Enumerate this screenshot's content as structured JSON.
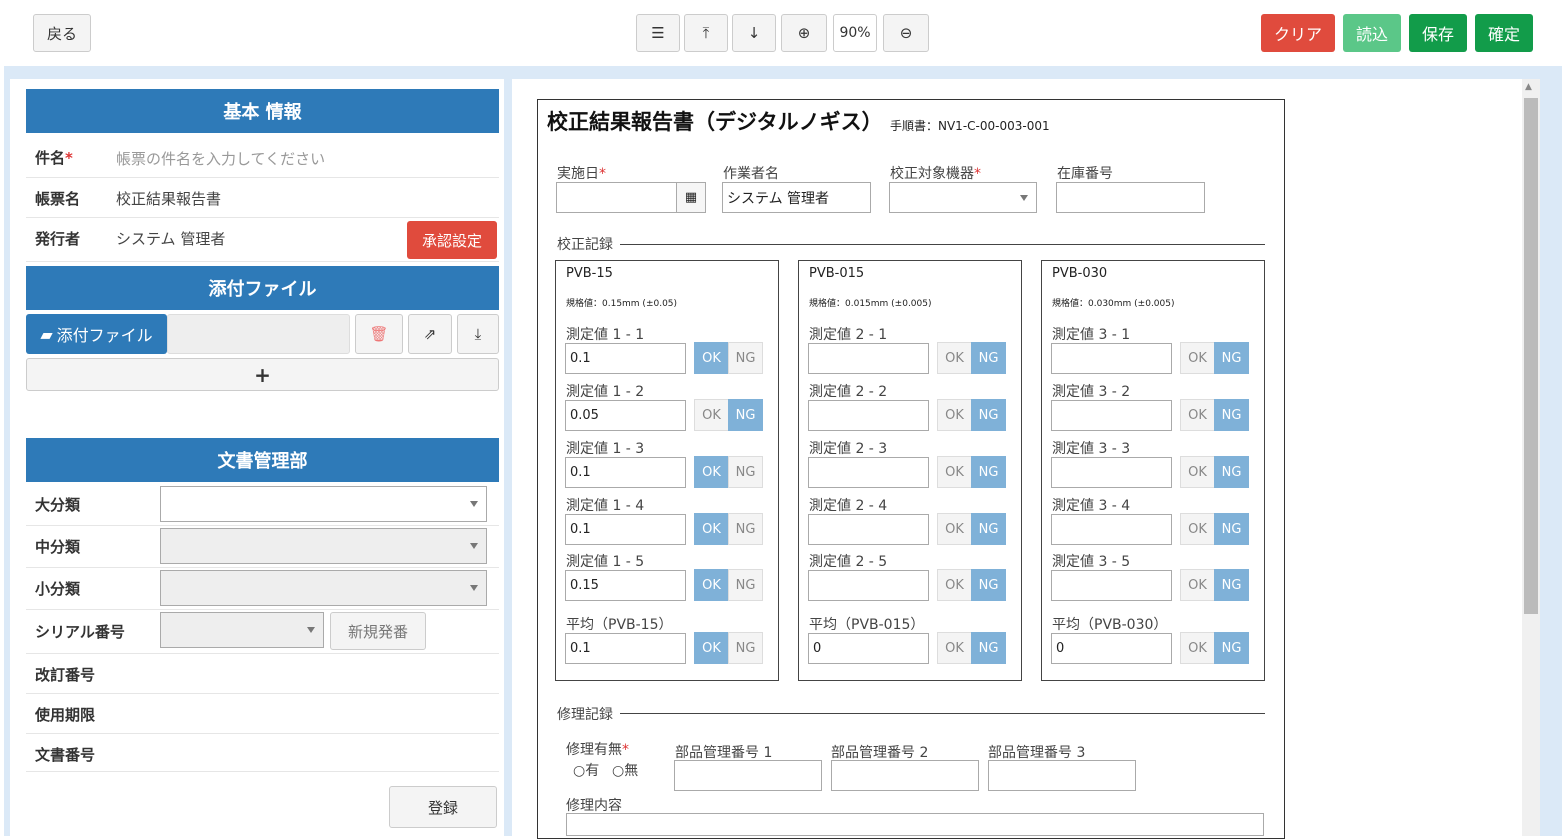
{
  "toolbar": {
    "back": "戻る",
    "zoom": "90%",
    "clear": "クリア",
    "load": "読込",
    "save": "保存",
    "confirm": "確定"
  },
  "left": {
    "basic_title": "基本 情報",
    "subject_label": "件名",
    "subject_placeholder": "帳票の件名を入力してください",
    "form_label": "帳票名",
    "form_value": "校正結果報告書",
    "issuer_label": "発行者",
    "issuer_value": "システム 管理者",
    "approval_btn": "承認設定",
    "attach_title": "添付ファイル",
    "attach_btn": "添付ファイル",
    "add": "+",
    "doc_title": "文書管理部",
    "cat_large": "大分類",
    "cat_mid": "中分類",
    "cat_small": "小分類",
    "serial_label": "シリアル番号",
    "new_serial": "新規発番",
    "revision": "改訂番号",
    "expiry": "使用期限",
    "docno": "文書番号",
    "register": "登録"
  },
  "doc": {
    "title": "校正結果報告書（デジタルノギス）",
    "procedure": "手順書：NV1-C-00-003-001",
    "date_label": "実施日",
    "worker_label": "作業者名",
    "worker_value": "システム 管理者",
    "device_label": "校正対象機器",
    "stock_label": "在庫番号",
    "calib_section": "校正記録",
    "ok": "OK",
    "ng": "NG",
    "groups": [
      {
        "name": "PVB-15",
        "spec": "規格値：0.15mm (±0.05)",
        "meas": [
          {
            "label": "測定値 1 - 1",
            "value": "0.1",
            "state": "ok"
          },
          {
            "label": "測定値 1 - 2",
            "value": "0.05",
            "state": "ng"
          },
          {
            "label": "測定値 1 - 3",
            "value": "0.1",
            "state": "ok"
          },
          {
            "label": "測定値 1 - 4",
            "value": "0.1",
            "state": "ok"
          },
          {
            "label": "測定値 1 - 5",
            "value": "0.15",
            "state": "ok"
          }
        ],
        "avg_label": "平均（PVB-15）",
        "avg_value": "0.1",
        "avg_state": "ok"
      },
      {
        "name": "PVB-015",
        "spec": "規格値：0.015mm (±0.005)",
        "meas": [
          {
            "label": "測定値 2 - 1",
            "value": "",
            "state": "ng"
          },
          {
            "label": "測定値 2 - 2",
            "value": "",
            "state": "ng"
          },
          {
            "label": "測定値 2 - 3",
            "value": "",
            "state": "ng"
          },
          {
            "label": "測定値 2 - 4",
            "value": "",
            "state": "ng"
          },
          {
            "label": "測定値 2 - 5",
            "value": "",
            "state": "ng"
          }
        ],
        "avg_label": "平均（PVB-015）",
        "avg_value": "0",
        "avg_state": "ng"
      },
      {
        "name": "PVB-030",
        "spec": "規格値：0.030mm (±0.005)",
        "meas": [
          {
            "label": "測定値 3 - 1",
            "value": "",
            "state": "ng"
          },
          {
            "label": "測定値 3 - 2",
            "value": "",
            "state": "ng"
          },
          {
            "label": "測定値 3 - 3",
            "value": "",
            "state": "ng"
          },
          {
            "label": "測定値 3 - 4",
            "value": "",
            "state": "ng"
          },
          {
            "label": "測定値 3 - 5",
            "value": "",
            "state": "ng"
          }
        ],
        "avg_label": "平均（PVB-030）",
        "avg_value": "0",
        "avg_state": "ng"
      }
    ],
    "repair_section": "修理記録",
    "repair_label": "修理有無",
    "yes": "有",
    "no": "無",
    "part1": "部品管理番号 1",
    "part2": "部品管理番号 2",
    "part3": "部品管理番号 3",
    "repair_content": "修理内容"
  }
}
